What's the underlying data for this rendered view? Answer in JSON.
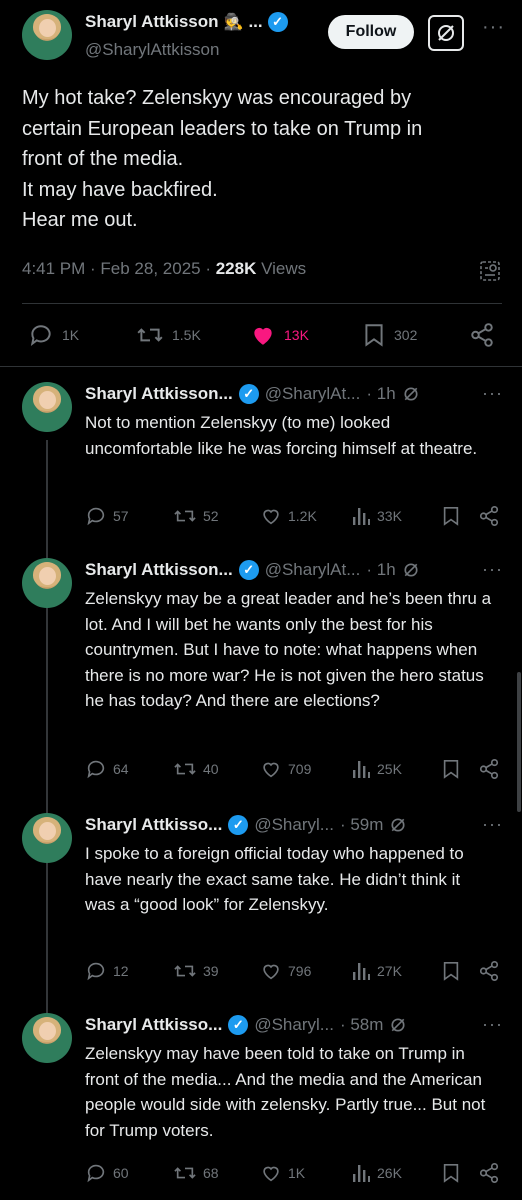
{
  "main_tweet": {
    "author_name": "Sharyl Attkisson",
    "name_emoji": "🕵",
    "name_ellipsis": "...",
    "handle": "@SharylAttkisson",
    "follow_label": "Follow",
    "text_lines": [
      "My hot take? Zelenskyy was encouraged by",
      "certain European leaders to take on Trump in",
      "front of the media.",
      "It may have backfired.",
      "Hear me out."
    ],
    "timestamp": "4:41 PM · Feb 28, 2025 · ",
    "views_count": "228K",
    "views_label": " Views",
    "replies": "1K",
    "reposts": "1.5K",
    "likes": "13K",
    "bookmarks": "302"
  },
  "replies": [
    {
      "name": "Sharyl Attkisson...",
      "handle": "@SharylAt...",
      "time": "· 1h",
      "text": "Not to mention Zelenskyy (to me) looked uncomfortable like he was forcing himself at theatre.",
      "replies": "57",
      "reposts": "52",
      "likes": "1.2K",
      "views": "33K"
    },
    {
      "name": "Sharyl Attkisson...",
      "handle": "@SharylAt...",
      "time": "· 1h",
      "text": "Zelenskyy may be a great leader and he’s been thru a lot. And I will bet he wants only the best for his countrymen. But I have to note: what happens when there is no more war? He is not given the hero status he has today? And there are elections?",
      "replies": "64",
      "reposts": "40",
      "likes": "709",
      "views": "25K"
    },
    {
      "name": "Sharyl Attkisso...",
      "handle": "@Sharyl...",
      "time": "· 59m",
      "text": "I spoke to a foreign official today who happened to have nearly the exact same take. He didn’t think it was a “good look” for Zelenskyy.",
      "replies": "12",
      "reposts": "39",
      "likes": "796",
      "views": "27K"
    },
    {
      "name": "Sharyl Attkisso...",
      "handle": "@Sharyl...",
      "time": "· 58m",
      "text": "Zelenskyy may have been told to take on Trump in front of the media... And the media and the American people would side with zelensky. Partly true... But not for Trump voters.",
      "replies": "60",
      "reposts": "68",
      "likes": "1K",
      "views": "26K"
    }
  ],
  "colors": {
    "background": "#000000",
    "text": "#e7e9ea",
    "muted": "#71767b",
    "verified": "#1d9bf0",
    "like": "#f91880"
  },
  "icons": [
    "verified-badge-icon",
    "grok-icon",
    "more-icon",
    "reply-icon",
    "repost-icon",
    "heart-icon",
    "bookmark-icon",
    "share-icon",
    "views-icon",
    "analytics-icon"
  ]
}
